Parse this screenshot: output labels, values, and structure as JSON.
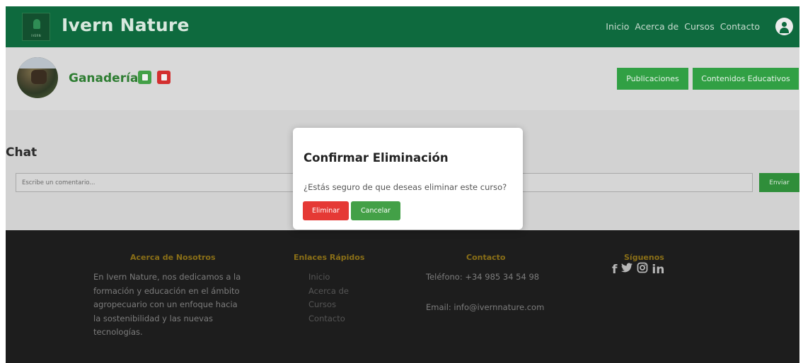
{
  "header": {
    "logo_text": "IVERN",
    "brand": "Ivern Nature",
    "nav": [
      "Inicio",
      "Acerca de",
      "Cursos",
      "Contacto"
    ]
  },
  "course": {
    "title": "Ganadería",
    "tabs": [
      "Publicaciones",
      "Contenidos Educativos"
    ]
  },
  "chat": {
    "title": "Chat",
    "placeholder": "Escribe un comentario...",
    "send_label": "Enviar"
  },
  "modal": {
    "title": "Confirmar Eliminación",
    "message": "¿Estás seguro de que deseas eliminar este curso?",
    "confirm_label": "Eliminar",
    "cancel_label": "Cancelar"
  },
  "footer": {
    "about_heading": "Acerca de Nosotros",
    "about_lines": [
      "En Ivern Nature, nos dedicamos a la",
      "formación y educación en el ámbito",
      "agropecuario con un enfoque hacia",
      "la sostenibilidad y las nuevas",
      "tecnologías."
    ],
    "links_heading": "Enlaces Rápidos",
    "links": [
      "Inicio",
      "Acerca de",
      "Cursos",
      "Contacto"
    ],
    "contact_heading": "Contacto",
    "phone": "Teléfono: +34 985 34 54 98",
    "email": "Email: info@ivernnature.com",
    "social_heading": "Síguenos",
    "social_icons": [
      "facebook-icon",
      "twitter-icon",
      "instagram-icon",
      "linkedin-icon"
    ]
  },
  "colors": {
    "header_green": "#0e6a3e",
    "button_green": "#31a044",
    "danger_red": "#e53935",
    "footer_bg": "#1d1d1d",
    "footer_heading": "#8a6f17"
  }
}
